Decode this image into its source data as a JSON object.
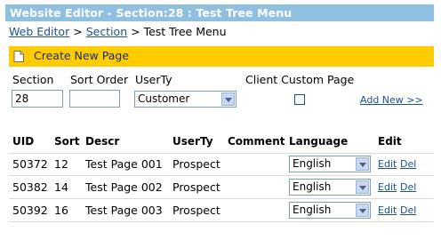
{
  "title": "Website Editor - Section:28 : Test Tree Menu",
  "breadcrumb": {
    "link1": "Web Editor",
    "sep1": ">",
    "link2": "Section",
    "sep2": ">",
    "current": "Test Tree Menu"
  },
  "toolbar": {
    "create_label": "Create New Page",
    "accent": "#ffcc00"
  },
  "form": {
    "labels": {
      "section": "Section",
      "sort_order": "Sort Order",
      "userty": "UserTy",
      "client_custom": "Client Custom Page"
    },
    "section_value": "28",
    "sort_order_value": "",
    "userty_value": "Customer",
    "client_custom_checked": false,
    "add_new": "Add New >>"
  },
  "table": {
    "headers": [
      "UID",
      "Sort",
      "Descr",
      "UserTy",
      "Comment",
      "Language",
      "Edit"
    ],
    "rows": [
      {
        "uid": "50372",
        "sort": "12",
        "descr": "Test Page 001",
        "userty": "Prospect",
        "comment": "",
        "language": "English",
        "edit": "Edit",
        "del": "Del"
      },
      {
        "uid": "50382",
        "sort": "14",
        "descr": "Test Page 002",
        "userty": "Prospect",
        "comment": "",
        "language": "English",
        "edit": "Edit",
        "del": "Del"
      },
      {
        "uid": "50392",
        "sort": "16",
        "descr": "Test Page 003",
        "userty": "Prospect",
        "comment": "",
        "language": "English",
        "edit": "Edit",
        "del": "Del"
      }
    ]
  },
  "colors": {
    "titlebar": "#8fc0e2",
    "link": "#1d4f8c",
    "panel": "#ffcc00"
  }
}
